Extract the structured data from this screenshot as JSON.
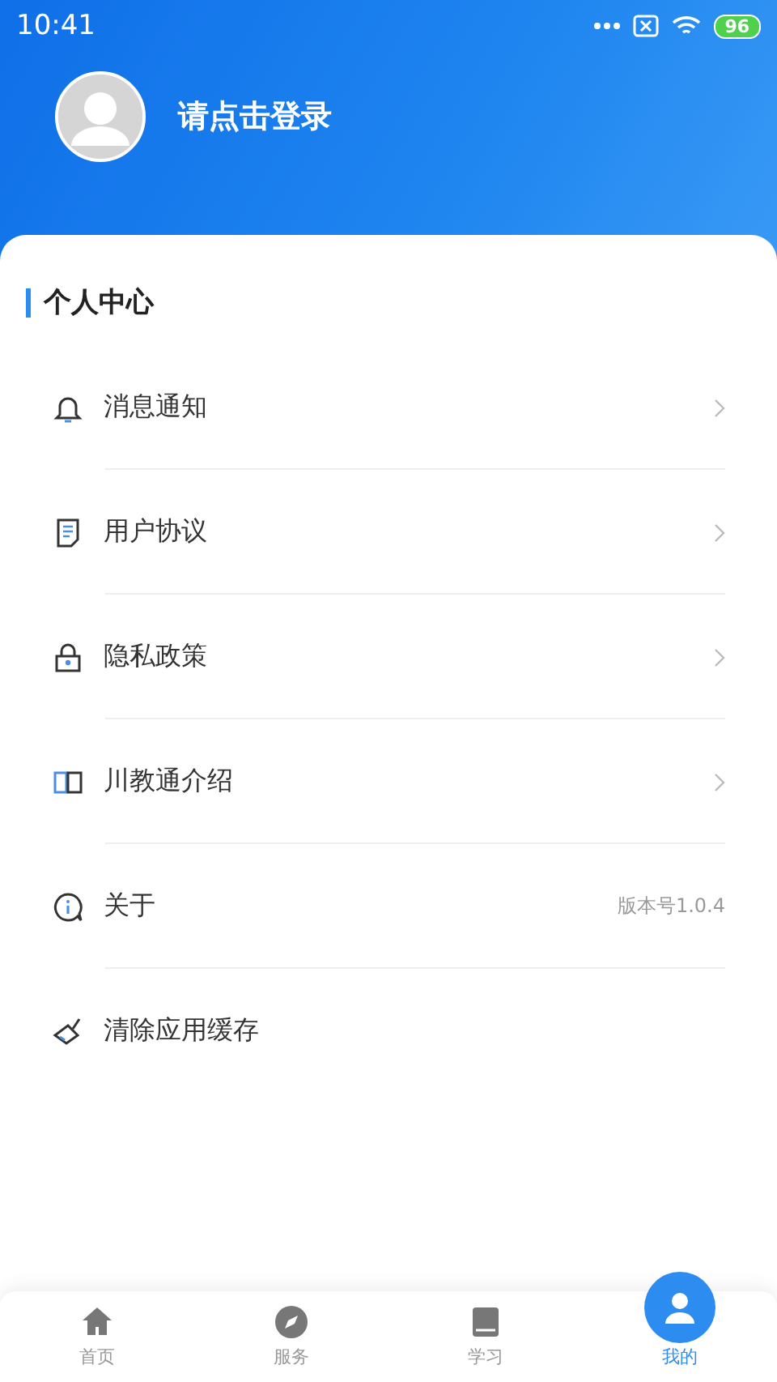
{
  "status_bar": {
    "time": "10:41",
    "battery": "96"
  },
  "profile": {
    "login_prompt": "请点击登录"
  },
  "section": {
    "title": "个人中心"
  },
  "menu": [
    {
      "label": "消息通知",
      "kind": "link"
    },
    {
      "label": "用户协议",
      "kind": "link"
    },
    {
      "label": "隐私政策",
      "kind": "link"
    },
    {
      "label": "川教通介绍",
      "kind": "link"
    },
    {
      "label": "关于",
      "kind": "value",
      "value": "版本号1.0.4"
    },
    {
      "label": "清除应用缓存",
      "kind": "action"
    }
  ],
  "tabs": [
    {
      "label": "首页",
      "selected": false
    },
    {
      "label": "服务",
      "selected": false
    },
    {
      "label": "学习",
      "selected": false
    },
    {
      "label": "我的",
      "selected": true
    }
  ]
}
